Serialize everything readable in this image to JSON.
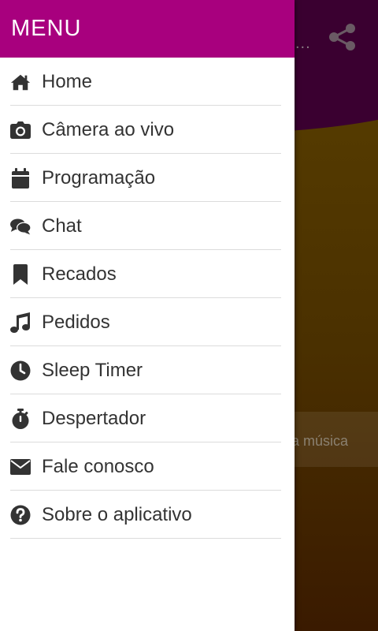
{
  "background_app": {
    "now_playing_text": "a música",
    "more_dots": "..."
  },
  "drawer": {
    "title": "MENU",
    "items": [
      {
        "label": "Home",
        "icon": "home-icon"
      },
      {
        "label": "Câmera ao vivo",
        "icon": "camera-icon"
      },
      {
        "label": "Programação",
        "icon": "calendar-icon"
      },
      {
        "label": "Chat",
        "icon": "chat-icon"
      },
      {
        "label": "Recados",
        "icon": "bookmark-icon"
      },
      {
        "label": "Pedidos",
        "icon": "music-note-icon"
      },
      {
        "label": "Sleep Timer",
        "icon": "clock-icon"
      },
      {
        "label": "Despertador",
        "icon": "stopwatch-icon"
      },
      {
        "label": "Fale conosco",
        "icon": "envelope-icon"
      },
      {
        "label": "Sobre o aplicativo",
        "icon": "question-circle-icon"
      }
    ]
  },
  "colors": {
    "drawer_header": "#a8007e",
    "app_header": "#3a0030",
    "icon": "#333333"
  }
}
